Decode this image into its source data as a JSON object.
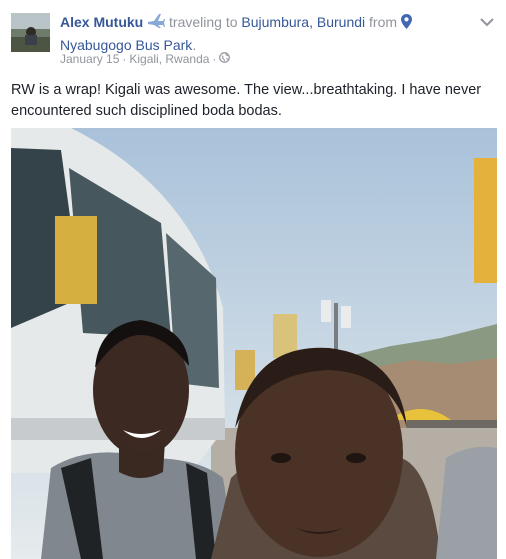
{
  "post": {
    "author_name": "Alex Mutuku",
    "activity_word": "traveling to",
    "destination": "Bujumbura, Burundi",
    "from_word": "from",
    "origin": "Nyabugogo Bus Park",
    "period": ".",
    "date": "January 15",
    "separator": " · ",
    "location": "Kigali, Rwanda",
    "separator2": " · ",
    "text": "RW is a wrap! Kigali was awesome. The view...breathtaking. I have never encountered such disciplined boda bodas."
  },
  "icons": {
    "plane": "airplane-icon",
    "pin": "location-pin-icon",
    "audience": "globe-icon",
    "menu": "chevron-down-icon"
  },
  "colors": {
    "link": "#365899",
    "muted": "#90949c",
    "text": "#1d2129",
    "plane": "#88a8d8",
    "sky": "#c5d6e6",
    "bus": "#e8ebec"
  }
}
